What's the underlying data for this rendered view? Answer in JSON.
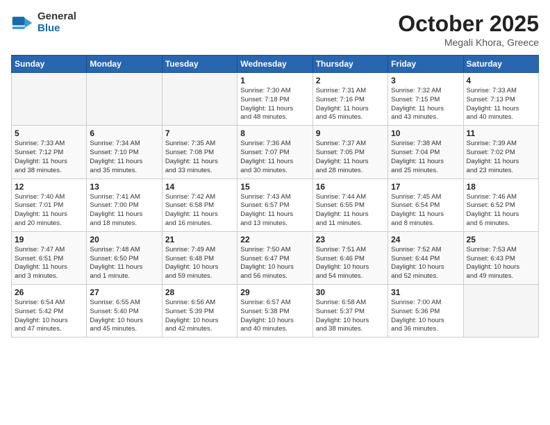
{
  "logo": {
    "general": "General",
    "blue": "Blue"
  },
  "title": "October 2025",
  "subtitle": "Megali Khora, Greece",
  "days_of_week": [
    "Sunday",
    "Monday",
    "Tuesday",
    "Wednesday",
    "Thursday",
    "Friday",
    "Saturday"
  ],
  "weeks": [
    [
      {
        "day": "",
        "info": ""
      },
      {
        "day": "",
        "info": ""
      },
      {
        "day": "",
        "info": ""
      },
      {
        "day": "1",
        "info": "Sunrise: 7:30 AM\nSunset: 7:18 PM\nDaylight: 11 hours\nand 48 minutes."
      },
      {
        "day": "2",
        "info": "Sunrise: 7:31 AM\nSunset: 7:16 PM\nDaylight: 11 hours\nand 45 minutes."
      },
      {
        "day": "3",
        "info": "Sunrise: 7:32 AM\nSunset: 7:15 PM\nDaylight: 11 hours\nand 43 minutes."
      },
      {
        "day": "4",
        "info": "Sunrise: 7:33 AM\nSunset: 7:13 PM\nDaylight: 11 hours\nand 40 minutes."
      }
    ],
    [
      {
        "day": "5",
        "info": "Sunrise: 7:33 AM\nSunset: 7:12 PM\nDaylight: 11 hours\nand 38 minutes."
      },
      {
        "day": "6",
        "info": "Sunrise: 7:34 AM\nSunset: 7:10 PM\nDaylight: 11 hours\nand 35 minutes."
      },
      {
        "day": "7",
        "info": "Sunrise: 7:35 AM\nSunset: 7:08 PM\nDaylight: 11 hours\nand 33 minutes."
      },
      {
        "day": "8",
        "info": "Sunrise: 7:36 AM\nSunset: 7:07 PM\nDaylight: 11 hours\nand 30 minutes."
      },
      {
        "day": "9",
        "info": "Sunrise: 7:37 AM\nSunset: 7:05 PM\nDaylight: 11 hours\nand 28 minutes."
      },
      {
        "day": "10",
        "info": "Sunrise: 7:38 AM\nSunset: 7:04 PM\nDaylight: 11 hours\nand 25 minutes."
      },
      {
        "day": "11",
        "info": "Sunrise: 7:39 AM\nSunset: 7:02 PM\nDaylight: 11 hours\nand 23 minutes."
      }
    ],
    [
      {
        "day": "12",
        "info": "Sunrise: 7:40 AM\nSunset: 7:01 PM\nDaylight: 11 hours\nand 20 minutes."
      },
      {
        "day": "13",
        "info": "Sunrise: 7:41 AM\nSunset: 7:00 PM\nDaylight: 11 hours\nand 18 minutes."
      },
      {
        "day": "14",
        "info": "Sunrise: 7:42 AM\nSunset: 6:58 PM\nDaylight: 11 hours\nand 16 minutes."
      },
      {
        "day": "15",
        "info": "Sunrise: 7:43 AM\nSunset: 6:57 PM\nDaylight: 11 hours\nand 13 minutes."
      },
      {
        "day": "16",
        "info": "Sunrise: 7:44 AM\nSunset: 6:55 PM\nDaylight: 11 hours\nand 11 minutes."
      },
      {
        "day": "17",
        "info": "Sunrise: 7:45 AM\nSunset: 6:54 PM\nDaylight: 11 hours\nand 8 minutes."
      },
      {
        "day": "18",
        "info": "Sunrise: 7:46 AM\nSunset: 6:52 PM\nDaylight: 11 hours\nand 6 minutes."
      }
    ],
    [
      {
        "day": "19",
        "info": "Sunrise: 7:47 AM\nSunset: 6:51 PM\nDaylight: 11 hours\nand 3 minutes."
      },
      {
        "day": "20",
        "info": "Sunrise: 7:48 AM\nSunset: 6:50 PM\nDaylight: 11 hours\nand 1 minute."
      },
      {
        "day": "21",
        "info": "Sunrise: 7:49 AM\nSunset: 6:48 PM\nDaylight: 10 hours\nand 59 minutes."
      },
      {
        "day": "22",
        "info": "Sunrise: 7:50 AM\nSunset: 6:47 PM\nDaylight: 10 hours\nand 56 minutes."
      },
      {
        "day": "23",
        "info": "Sunrise: 7:51 AM\nSunset: 6:46 PM\nDaylight: 10 hours\nand 54 minutes."
      },
      {
        "day": "24",
        "info": "Sunrise: 7:52 AM\nSunset: 6:44 PM\nDaylight: 10 hours\nand 52 minutes."
      },
      {
        "day": "25",
        "info": "Sunrise: 7:53 AM\nSunset: 6:43 PM\nDaylight: 10 hours\nand 49 minutes."
      }
    ],
    [
      {
        "day": "26",
        "info": "Sunrise: 6:54 AM\nSunset: 5:42 PM\nDaylight: 10 hours\nand 47 minutes."
      },
      {
        "day": "27",
        "info": "Sunrise: 6:55 AM\nSunset: 5:40 PM\nDaylight: 10 hours\nand 45 minutes."
      },
      {
        "day": "28",
        "info": "Sunrise: 6:56 AM\nSunset: 5:39 PM\nDaylight: 10 hours\nand 42 minutes."
      },
      {
        "day": "29",
        "info": "Sunrise: 6:57 AM\nSunset: 5:38 PM\nDaylight: 10 hours\nand 40 minutes."
      },
      {
        "day": "30",
        "info": "Sunrise: 6:58 AM\nSunset: 5:37 PM\nDaylight: 10 hours\nand 38 minutes."
      },
      {
        "day": "31",
        "info": "Sunrise: 7:00 AM\nSunset: 5:36 PM\nDaylight: 10 hours\nand 36 minutes."
      },
      {
        "day": "",
        "info": ""
      }
    ]
  ]
}
